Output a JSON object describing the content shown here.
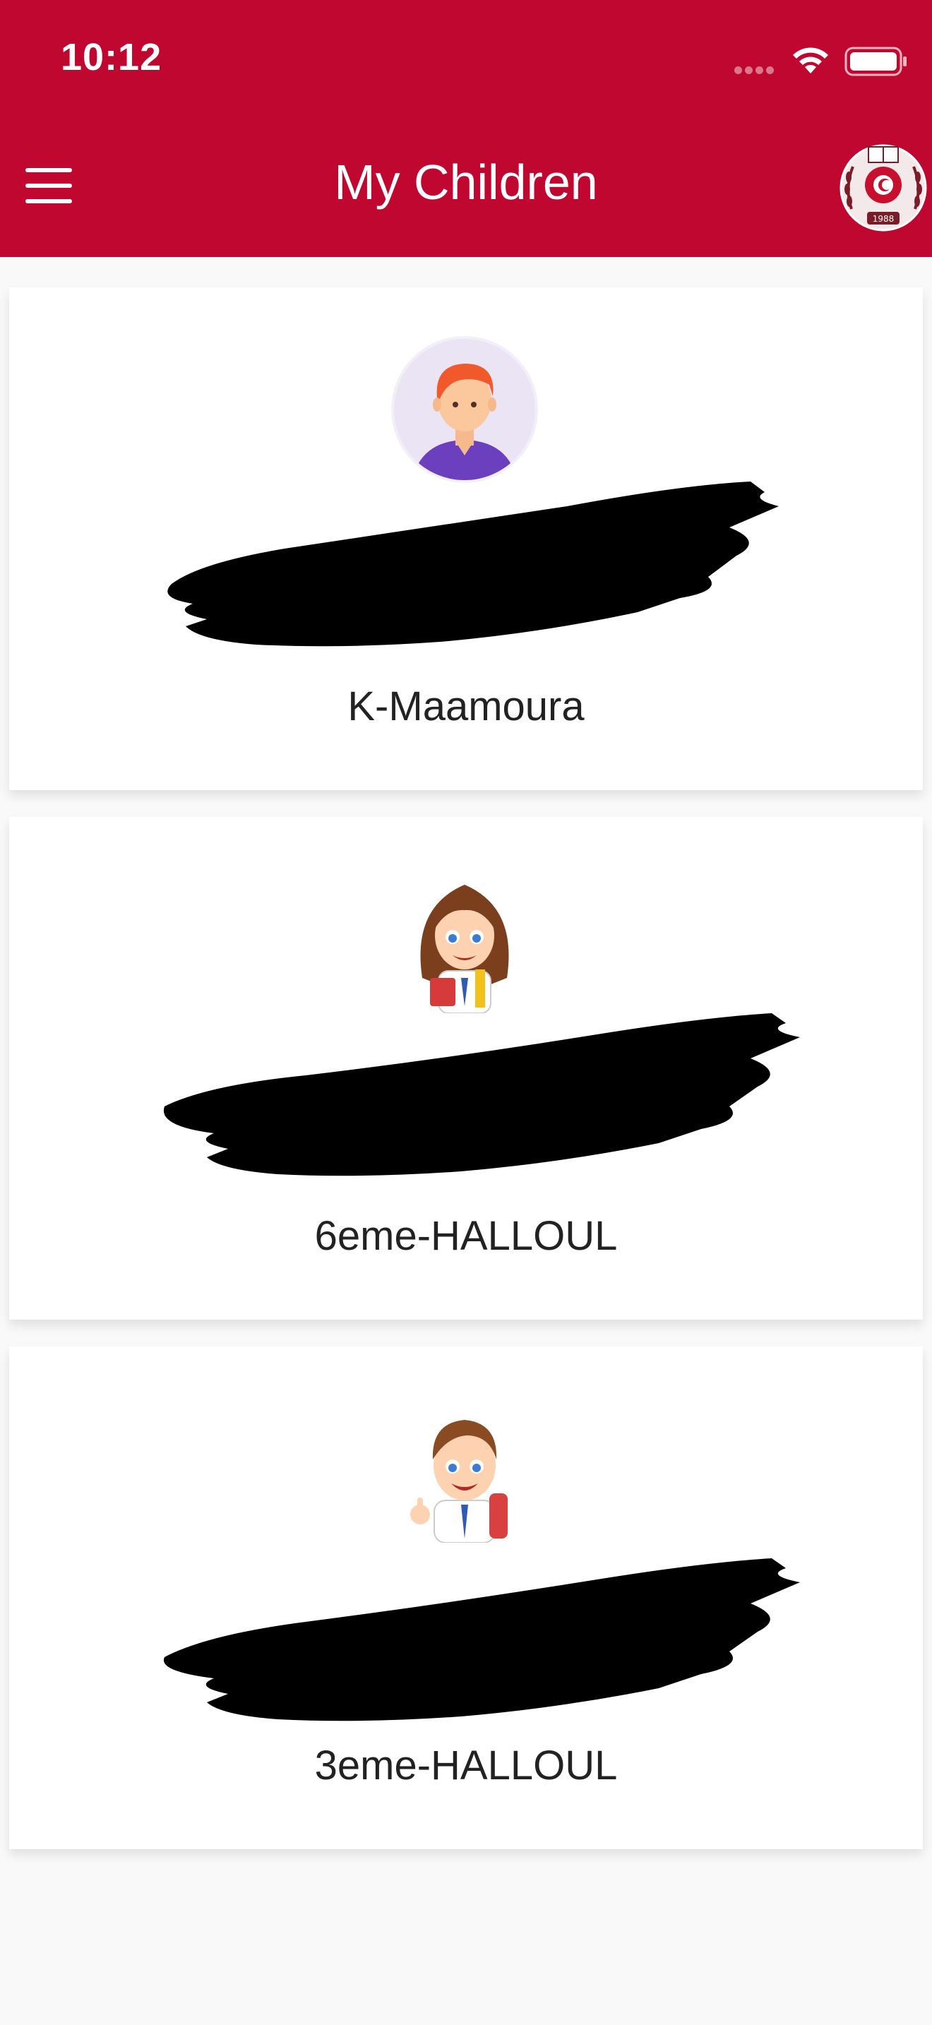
{
  "status_bar": {
    "time": "10:12"
  },
  "header": {
    "title": "My Children",
    "logo_year": "1988"
  },
  "children": [
    {
      "class_label": "K-Maamoura",
      "avatar": "boy-avatar-icon"
    },
    {
      "class_label": "6eme-HALLOUL",
      "avatar": "girl-cartoon-icon"
    },
    {
      "class_label": "3eme-HALLOUL",
      "avatar": "boy-cartoon-icon"
    }
  ],
  "colors": {
    "header": "#bf0730",
    "background": "#f9f9f9",
    "card": "#ffffff"
  }
}
